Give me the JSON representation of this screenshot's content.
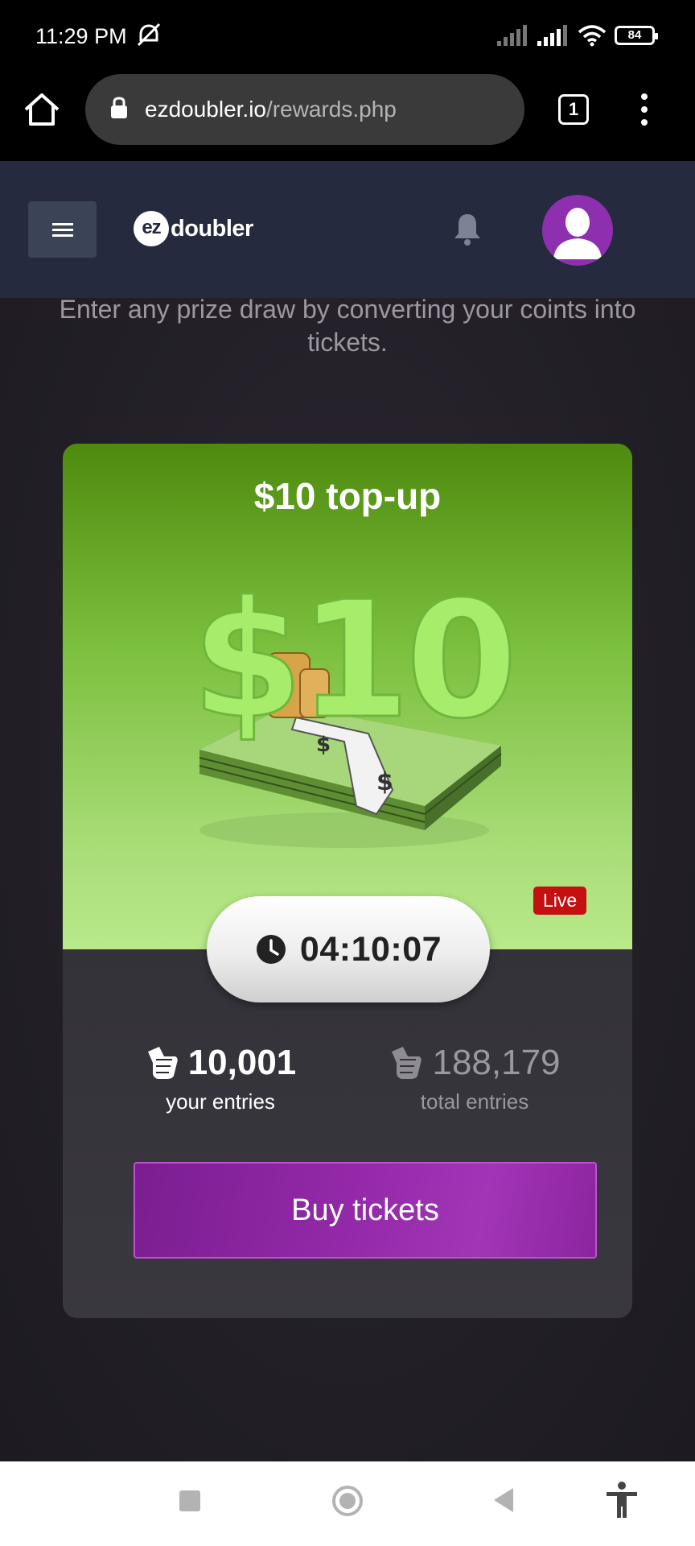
{
  "status_bar": {
    "time": "11:29 PM",
    "battery": "84"
  },
  "browser": {
    "url_domain": "ezdoubler.io",
    "url_path": "/rewards.php",
    "tab_count": "1"
  },
  "app": {
    "logo_badge": "ez",
    "logo_text": "doubler"
  },
  "main": {
    "intro": "Enter any prize draw by converting your coints into tickets."
  },
  "prize": {
    "title": "$10 top-up",
    "art_amount": "$10",
    "live_label": "Live",
    "countdown": "04:10:07",
    "your_entries": "10,001",
    "your_entries_label": "your entries",
    "total_entries": "188,179",
    "total_entries_label": "total entries",
    "buy_label": "Buy tickets"
  },
  "colors": {
    "accent_purple": "#952aaa",
    "live_red": "#c41010",
    "header_bg": "#262a3e",
    "card_green": "#7cbf3e"
  }
}
